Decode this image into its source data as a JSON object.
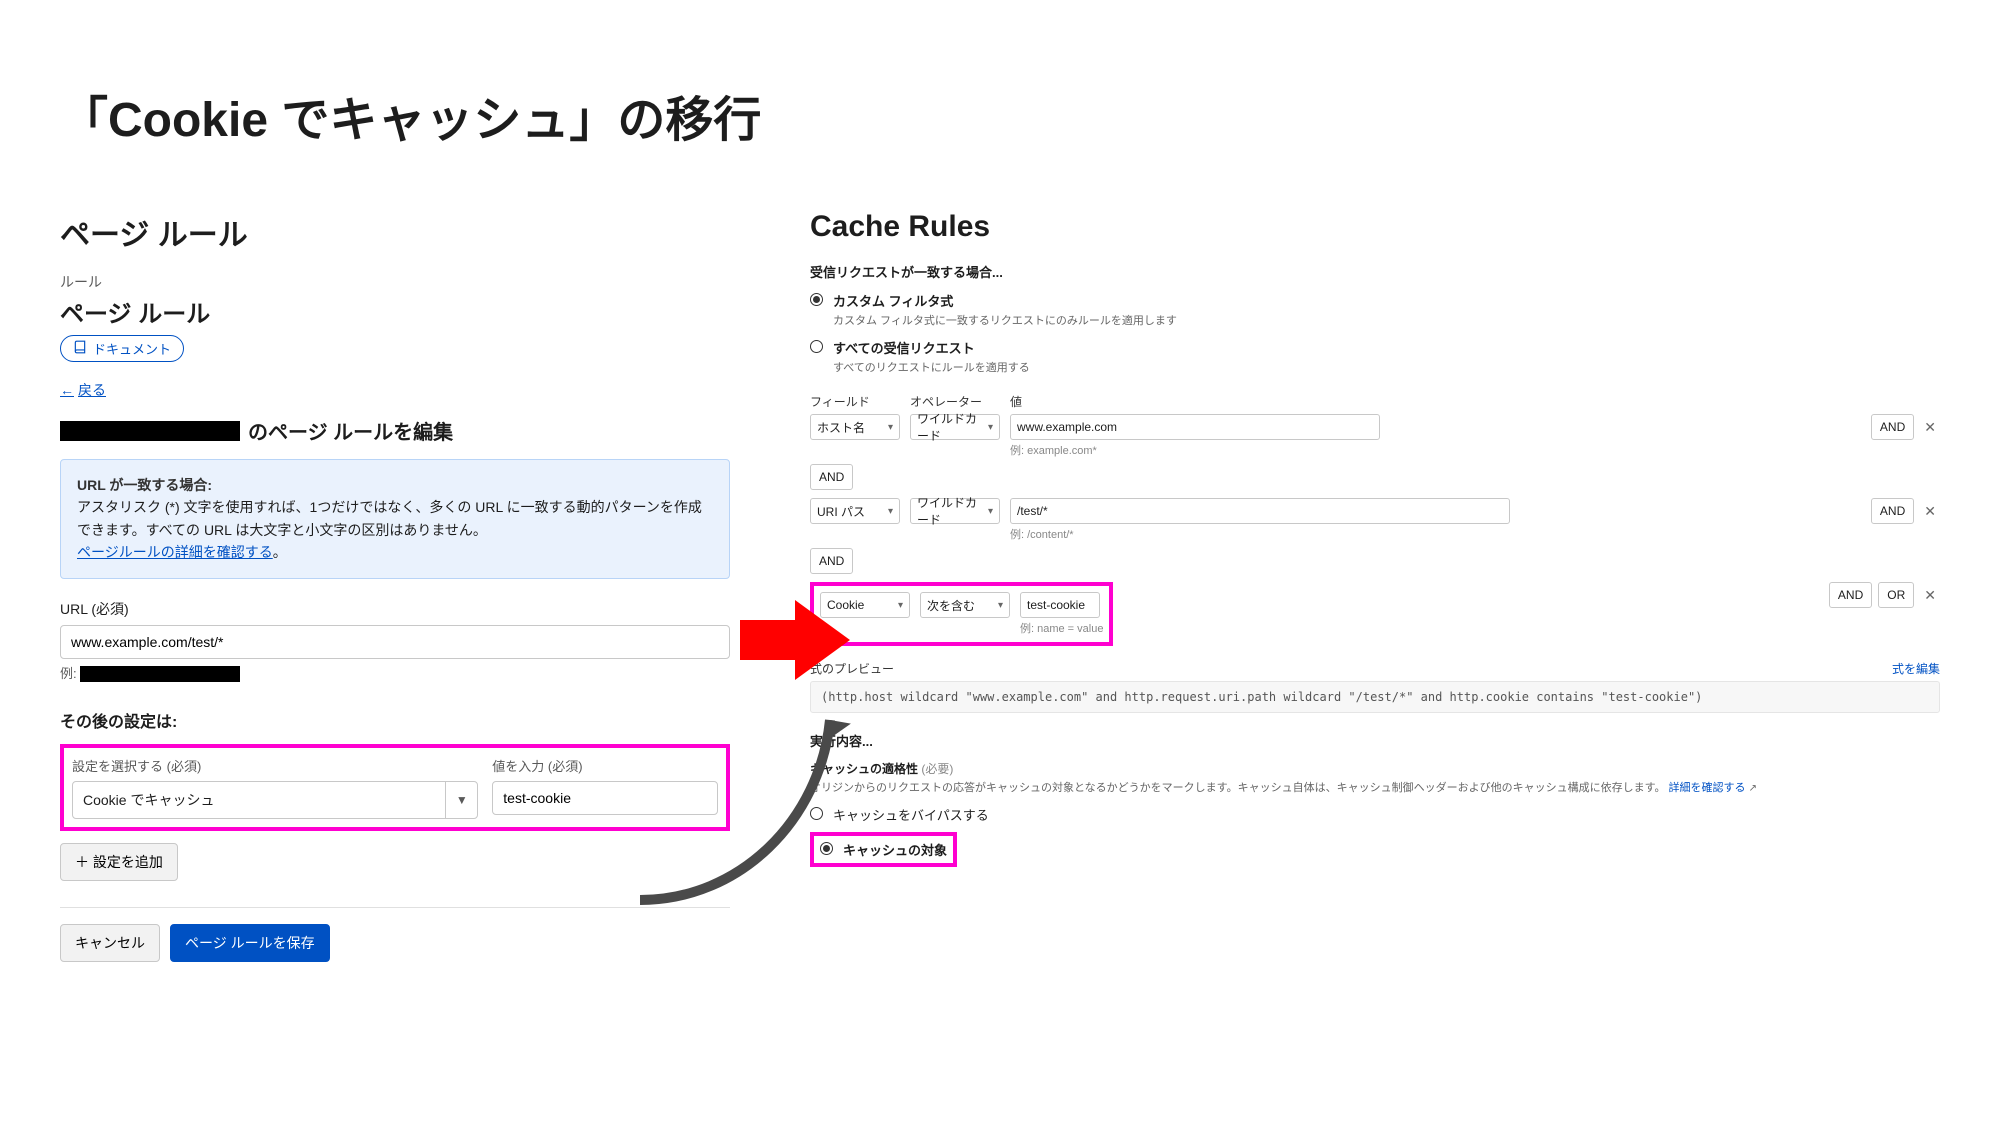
{
  "page": {
    "title": "「Cookie でキャッシュ」の移行"
  },
  "left": {
    "heading": "ページ ルール",
    "breadcrumb": "ルール",
    "sub_heading": "ページ ルール",
    "doc_pill": "ドキュメント",
    "back": "戻る",
    "edit_title_suffix": "のページ ルールを編集",
    "info": {
      "title": "URL が一致する場合:",
      "body": "アスタリスク (*) 文字を使用すれば、1つだけではなく、多くの URL に一致する動的パターンを作成できます。すべての URL は大文字と小文字の区別はありません。",
      "link": "ページルールの詳細を確認する"
    },
    "url_label": "URL (必須)",
    "url_value": "www.example.com/test/*",
    "example_label": "例:",
    "after_label": "その後の設定は:",
    "setting_select_label": "設定を選択する (必須)",
    "setting_select_value": "Cookie でキャッシュ",
    "value_label": "値を入力 (必須)",
    "value_input": "test-cookie",
    "add_setting": "＋ 設定を追加",
    "cancel": "キャンセル",
    "save": "ページ ルールを保存"
  },
  "right": {
    "heading": "Cache Rules",
    "match_label": "受信リクエストが一致する場合...",
    "radio_custom": {
      "title": "カスタム フィルタ式",
      "sub": "カスタム フィルタ式に一致するリクエストにのみルールを適用します"
    },
    "radio_all": {
      "title": "すべての受信リクエスト",
      "sub": "すべてのリクエストにルールを適用する"
    },
    "col_field": "フィールド",
    "col_op": "オペレーター",
    "col_val": "値",
    "rows": [
      {
        "field": "ホスト名",
        "op": "ワイルドカード",
        "val": "www.example.com",
        "hint": "例: example.com*"
      },
      {
        "field": "URI パス",
        "op": "ワイルドカード",
        "val": "/test/*",
        "hint": "例: /content/*"
      },
      {
        "field": "Cookie",
        "op": "次を含む",
        "val": "test-cookie",
        "hint": "例: name = value"
      }
    ],
    "and": "AND",
    "or": "OR",
    "preview_label": "式のプレビュー",
    "preview_edit": "式を編集",
    "preview_code": "(http.host wildcard \"www.example.com\" and http.request.uri.path wildcard \"/test/*\" and http.cookie contains \"test-cookie\")",
    "exec_label": "実行内容...",
    "eligibility_label": "キャッシュの適格性",
    "eligibility_req": "(必要)",
    "eligibility_sub": "オリジンからのリクエストの応答がキャッシュの対象となるかどうかをマークします。キャッシュ自体は、キャッシュ制御ヘッダーおよび他のキャッシュ構成に依存します。",
    "eligibility_link": "詳細を確認する",
    "radio_bypass": "キャッシュをバイパスする",
    "radio_target": "キャッシュの対象"
  }
}
